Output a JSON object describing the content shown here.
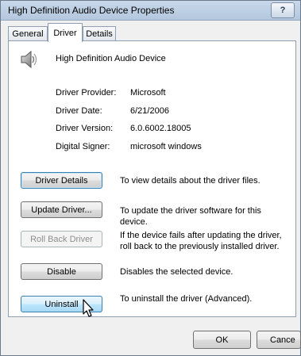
{
  "window": {
    "title": "High Definition Audio Device Properties",
    "help_label": "?"
  },
  "tabs": [
    {
      "label": "General",
      "active": false
    },
    {
      "label": "Driver",
      "active": true
    },
    {
      "label": "Details",
      "active": false
    }
  ],
  "device": {
    "icon": "speaker-icon",
    "name": "High Definition Audio Device"
  },
  "driver_info": [
    {
      "label": "Driver Provider:",
      "value": "Microsoft"
    },
    {
      "label": "Driver Date:",
      "value": "6/21/2006"
    },
    {
      "label": "Driver Version:",
      "value": "6.0.6002.18005"
    },
    {
      "label": "Digital Signer:",
      "value": "microsoft windows"
    }
  ],
  "actions": [
    {
      "label": "Driver Details",
      "description": "To view details about the driver files.",
      "state": "focused"
    },
    {
      "label": "Update Driver...",
      "description": "To update the driver software for this device.",
      "state": "normal"
    },
    {
      "label": "Roll Back Driver",
      "description": "If the device fails after updating the driver, roll back to the previously installed driver.",
      "state": "disabled"
    },
    {
      "label": "Disable",
      "description": "Disables the selected device.",
      "state": "normal"
    },
    {
      "label": "Uninstall",
      "description": "To uninstall the driver (Advanced).",
      "state": "hover"
    }
  ],
  "footer": {
    "ok_label": "OK",
    "cancel_label": "Cance"
  },
  "colors": {
    "titlebar": "#b3c7de",
    "focus_border": "#3c7fb1",
    "hover_fill": "#bee6fd"
  }
}
